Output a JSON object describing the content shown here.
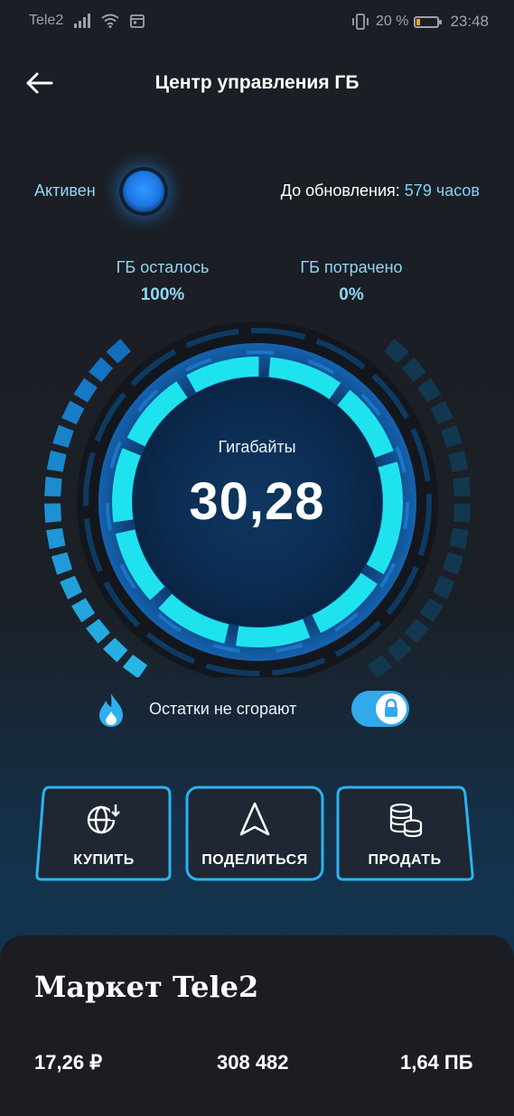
{
  "status_bar": {
    "carrier": "Tele2",
    "battery": "20 %",
    "battery_level": 0.2,
    "time": "23:48",
    "icons": [
      "signal-icon",
      "wifi-icon",
      "calendar-icon",
      "vibrate-icon",
      "battery-icon"
    ]
  },
  "header": {
    "title": "Центр управления ГБ",
    "back_icon": "arrow-left-icon"
  },
  "status_row": {
    "active_label": "Активен",
    "renewal_label": "До обновления:",
    "renewal_value": "579 часов"
  },
  "gauge": {
    "left_label": "ГБ осталось",
    "left_value": "100%",
    "left_level": 1.0,
    "right_label": "ГБ потрачено",
    "right_value": "0%",
    "right_level": 0.0,
    "title": "Гигабайты",
    "value": "30,28"
  },
  "rollover": {
    "label": "Остатки не сгорают",
    "enabled": true
  },
  "actions": [
    {
      "label": "КУПИТЬ",
      "icon": "globe-download-icon"
    },
    {
      "label": "ПОДЕЛИТЬСЯ",
      "icon": "navigation-arrow-icon"
    },
    {
      "label": "ПРОДАТЬ",
      "icon": "coins-icon"
    }
  ],
  "market": {
    "title": "Маркет Tele2",
    "stats": [
      "17,26 ₽",
      "308 482",
      "1,64 ПБ"
    ]
  },
  "colors": {
    "accent": "#31a9ea",
    "highlight": "#7fd4f6",
    "ring": "#1ee3ee",
    "background": "#1b1e24"
  }
}
